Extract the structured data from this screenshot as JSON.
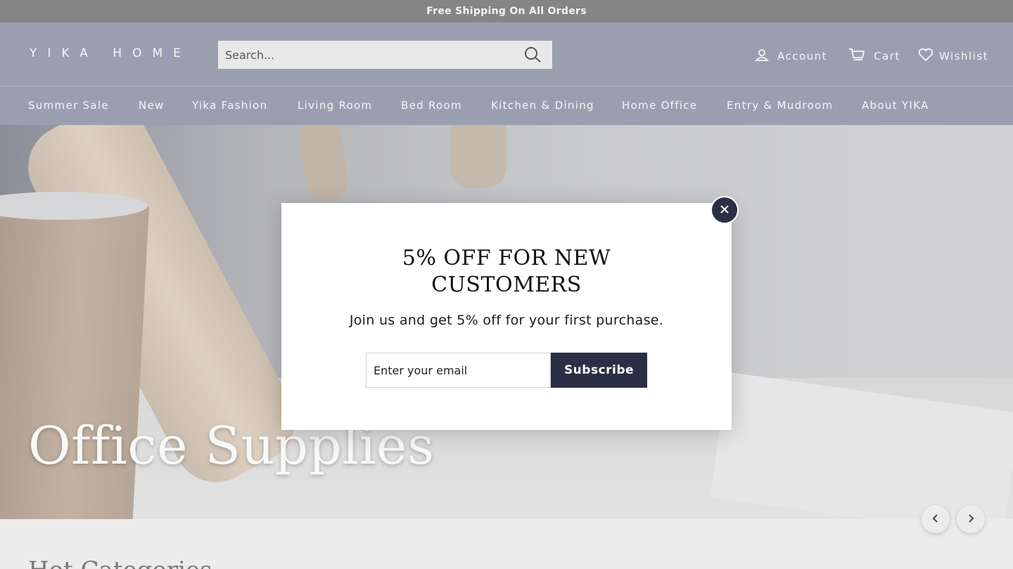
{
  "announcement": {
    "text": "Free Shipping On All Orders"
  },
  "header": {
    "logo": "YIKA HOME",
    "search": {
      "placeholder": "Search..."
    },
    "utility": {
      "account": "Account",
      "cart": "Cart",
      "wishlist": "Wishlist"
    }
  },
  "nav": {
    "items": [
      {
        "label": "Summer Sale"
      },
      {
        "label": "New"
      },
      {
        "label": "Yika Fashion"
      },
      {
        "label": "Living Room"
      },
      {
        "label": "Bed Room"
      },
      {
        "label": "Kitchen & Dining"
      },
      {
        "label": "Home Office"
      },
      {
        "label": "Entry & Mudroom"
      },
      {
        "label": "About YIKA"
      }
    ]
  },
  "hero": {
    "title": "Office Supplies"
  },
  "section": {
    "title": "Hot Categories"
  },
  "popup": {
    "title_line1": "5% OFF FOR NEW",
    "title_line2": "CUSTOMERS",
    "subtitle": "Join us and get 5% off for your first purchase.",
    "email_placeholder": "Enter your email",
    "subscribe_label": "Subscribe"
  },
  "icons": {
    "search": "search-icon",
    "account": "user-icon",
    "cart": "cart-icon",
    "wishlist": "heart-icon",
    "close": "close-icon",
    "prev": "chevron-left-icon",
    "next": "chevron-right-icon"
  },
  "colors": {
    "announcement_bg": "#858585",
    "header_bg": "#9a9fb0",
    "accent_dark": "#2b2f45",
    "page_bg": "#ececec"
  }
}
